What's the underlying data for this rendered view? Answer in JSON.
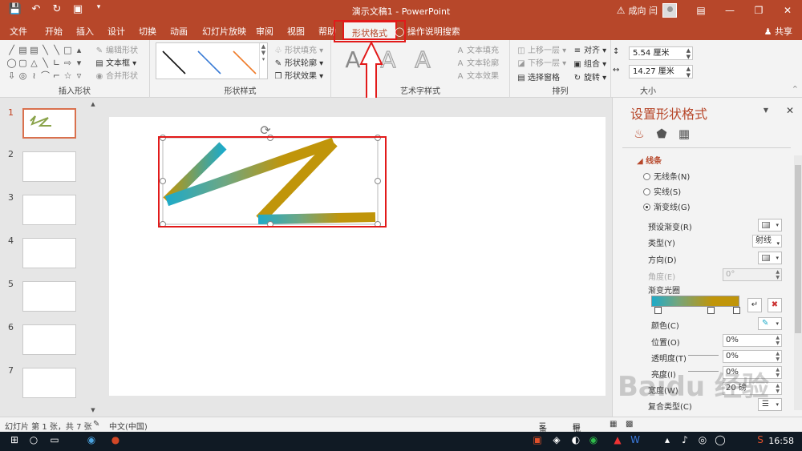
{
  "titlebar": {
    "document_title": "演示文稿1 - PowerPoint",
    "user_name": "成向 闫",
    "qat_icons": [
      "save-icon",
      "undo-icon",
      "redo-icon",
      "present-icon"
    ]
  },
  "tabs": {
    "items": [
      "文件",
      "开始",
      "插入",
      "设计",
      "切换",
      "动画",
      "幻灯片放映",
      "审阅",
      "视图",
      "帮助"
    ],
    "active": "形状格式",
    "tell_me": "操作说明搜索",
    "share": "共享"
  },
  "ribbon": {
    "insert_shapes": {
      "label": "插入形状",
      "edit_shape": "编辑形状",
      "text_box": "文本框",
      "merge_shapes": "合并形状"
    },
    "shape_styles": {
      "label": "形状样式",
      "fill": "形状填充",
      "outline": "形状轮廓",
      "effects": "形状效果"
    },
    "wordart": {
      "label": "艺术字样式",
      "letter": "A",
      "text_fill": "文本填充",
      "text_outline": "文本轮廓",
      "text_effects": "文本效果"
    },
    "arrange": {
      "label": "排列",
      "bring_forward": "上移一层",
      "send_backward": "下移一层",
      "selection_pane": "选择窗格",
      "align": "对齐",
      "group": "组合",
      "rotate": "旋转"
    },
    "size": {
      "label": "大小",
      "height": "5.54 厘米",
      "width": "14.27 厘米"
    }
  },
  "slides_panel": {
    "numbers": [
      "1",
      "2",
      "3",
      "4",
      "5",
      "6",
      "7"
    ],
    "active_index": 0
  },
  "format_pane": {
    "title": "设置形状格式",
    "section": "线条",
    "line_options": [
      "无线条(N)",
      "实线(S)",
      "渐变线(G)"
    ],
    "selected_option": "渐变线(G)",
    "props": {
      "preset_gradient": "预设渐变(R)",
      "type": "类型(Y)",
      "type_value": "射线",
      "direction": "方向(D)",
      "angle": "角度(E)",
      "angle_value": "0°",
      "gradient_stops": "渐变光圈",
      "color": "颜色(C)",
      "position": "位置(O)",
      "position_value": "0%",
      "transparency": "透明度(T)",
      "transparency_value": "0%",
      "brightness": "亮度(I)",
      "brightness_value": "0%",
      "width_label": "宽度(W)",
      "width_value": "20 磅",
      "compound": "复合类型(C)"
    }
  },
  "statusbar": {
    "slide_info": "幻灯片 第 1 张，共 7 张",
    "language": "中文(中国)",
    "notes": "备注",
    "comments": "批注"
  },
  "taskbar": {
    "clock": "16:58"
  },
  "watermark": "Baidu 经验",
  "colors": {
    "accent": "#b7472a",
    "highlight": "#e21a1a",
    "gradient_start": "#1eaac8",
    "gradient_end": "#c0950a"
  }
}
